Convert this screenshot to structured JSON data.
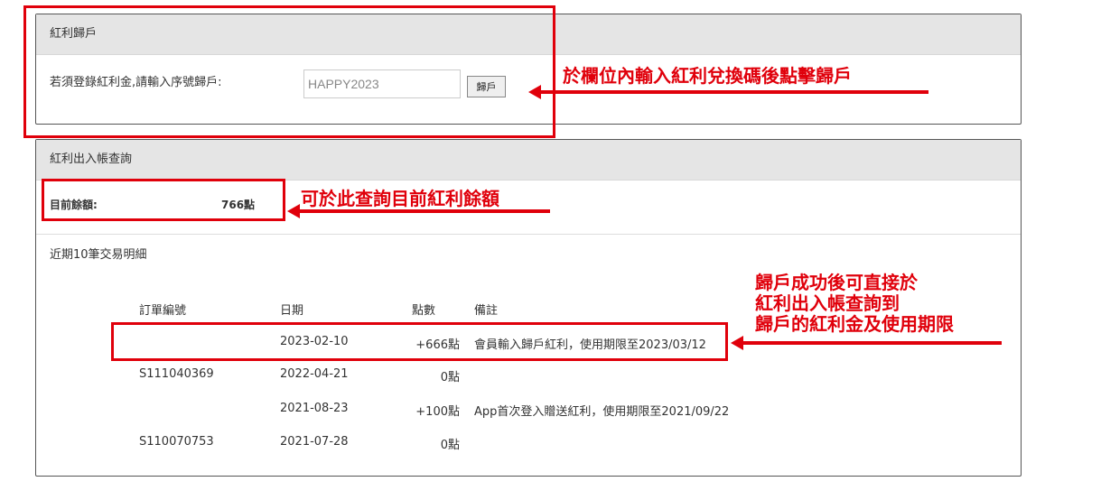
{
  "redeem_panel": {
    "title": "紅利歸戶",
    "label": "若須登錄紅利金,請輸入序號歸戶:",
    "input_value": "HAPPY2023",
    "button_label": "歸戶"
  },
  "ledger_panel": {
    "title": "紅利出入帳查詢",
    "balance_label": "目前餘額:",
    "balance_value": "766點",
    "recent_title": "近期10筆交易明細",
    "columns": [
      "訂單編號",
      "日期",
      "點數",
      "備註"
    ],
    "rows": [
      {
        "order": "",
        "date": "2023-02-10",
        "points": "+666點",
        "note": "會員輸入歸戶紅利，使用期限至2023/03/12"
      },
      {
        "order": "S111040369",
        "date": "2022-04-21",
        "points": "0點",
        "note": ""
      },
      {
        "order": "",
        "date": "2021-08-23",
        "points": "+100點",
        "note": "App首次登入贈送紅利，使用期限至2021/09/22"
      },
      {
        "order": "S110070753",
        "date": "2021-07-28",
        "points": "0點",
        "note": ""
      }
    ]
  },
  "annotations": {
    "redeem_tip": "於欄位內輸入紅利兌換碼後點擊歸戶",
    "balance_tip": "可於此查詢目前紅利餘額",
    "ledger_tip_line1": "歸戶成功後可直接於",
    "ledger_tip_line2": "紅利出入帳查詢到",
    "ledger_tip_line3": "歸戶的紅利金及使用期限"
  },
  "colors": {
    "annotation_red": "#e0000b",
    "panel_header_bg": "#e5e5e5"
  }
}
